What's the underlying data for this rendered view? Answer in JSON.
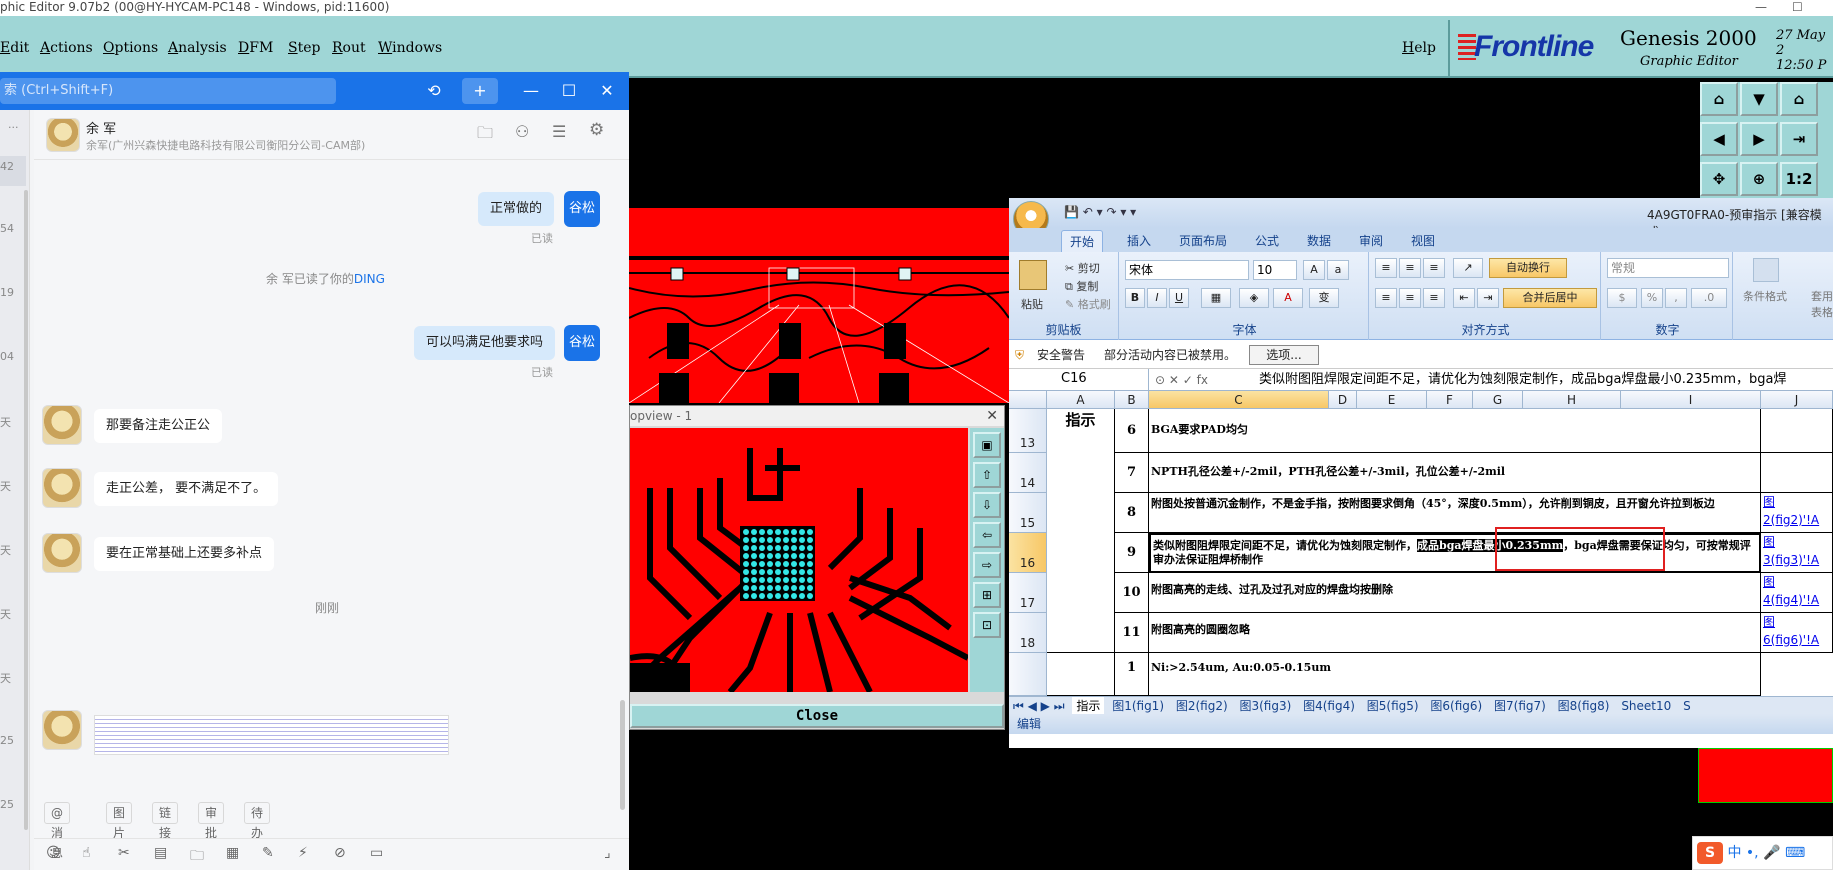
{
  "window": {
    "title": "phic Editor 9.07b2 (00@HY-HYCAM-PC148 - Windows, pid:11600)",
    "controls": [
      "—",
      "☐"
    ]
  },
  "genesis": {
    "menu": [
      "Edit",
      "Actions",
      "Options",
      "Analysis",
      "DFM",
      "Step",
      "Rout",
      "Windows"
    ],
    "help": "Help",
    "logo": "Frontline",
    "product": "Genesis 2000",
    "subtitle": "Graphic Editor",
    "date": "27 May 2",
    "time": "12:50 P",
    "toolbar_ratio": "1:2"
  },
  "chat": {
    "search_placeholder": "索 (Ctrl+Shift+F)",
    "contact_name": "余 军",
    "contact_org": "余军(广州兴森快捷电路科技有限公司衡阳分公司-CAM部)",
    "sidebar_times": [
      "42",
      "54",
      "19",
      "04",
      "天",
      "天",
      "天",
      "天",
      "天",
      "25",
      "25"
    ],
    "sidebar_dots": "...",
    "messages": [
      {
        "from": "me",
        "text": "正常做的",
        "badge": "谷松",
        "status": "已读"
      },
      {
        "from": "system",
        "text_pre": "余 军已读了你的",
        "text_link": "DING"
      },
      {
        "from": "me",
        "text": "可以吗满足他要求吗",
        "badge": "谷松",
        "status": "已读"
      },
      {
        "from": "other",
        "text": "那要备注走公正公"
      },
      {
        "from": "other",
        "text": "走正公差， 要不满足不了。"
      },
      {
        "from": "other",
        "text": "要在正常基础上还要多补点"
      },
      {
        "from": "time",
        "text": "刚刚"
      }
    ],
    "quick_actions": [
      "@消息",
      "图片",
      "链接",
      "审批",
      "待办"
    ]
  },
  "popview": {
    "title": "opview - 1",
    "close_label": "Close"
  },
  "excel": {
    "title": "4A9GT0FRA0-预审指示 [兼容模式",
    "tabs": [
      "开始",
      "插入",
      "页面布局",
      "公式",
      "数据",
      "审阅",
      "视图"
    ],
    "ribbon": {
      "paste": "粘贴",
      "cut": "剪切",
      "copy": "复制",
      "format_painter": "格式刷",
      "clipboard": "剪贴板",
      "font_name": "宋体",
      "font_size": "10",
      "font_group": "字体",
      "wrap": "自动换行",
      "merge": "合并后居中",
      "align_group": "对齐方式",
      "number_format": "常规",
      "number_group": "数字",
      "cond_format": "条件格式",
      "table_format": "套用\n表格格"
    },
    "security_label": "安全警告",
    "security_text": "部分活动内容已被禁用。",
    "security_btn": "选项...",
    "namebox": "C16",
    "formula": "类似附图阻焊限定间距不足，请优化为蚀刻限定制作，成品bga焊盘最小0.235mm，bga焊",
    "columns": [
      "A",
      "B",
      "C",
      "D",
      "E",
      "F",
      "G",
      "H",
      "I",
      "J"
    ],
    "section_label": "指示",
    "rows": [
      {
        "row": "13",
        "num": "6",
        "text": "BGA要求PAD均匀",
        "link": ""
      },
      {
        "row": "14",
        "num": "7",
        "text": "NPTH孔径公差+/-2mil，PTH孔径公差+/-3mil，孔位公差+/-2mil",
        "link": ""
      },
      {
        "row": "15",
        "num": "8",
        "text": "附图处按普通沉金制作，不是金手指，按附图要求倒角（45°，深度0.5mm），允许削到铜皮，且开窗允许拉到板边",
        "link": "图\n2(fig2)'!A"
      },
      {
        "row": "16",
        "num": "9",
        "text_pre": "类似附图阻焊限定间距不足，请优化为蚀刻限定制作，",
        "text_sel": "成品bga焊盘最小0.235mm",
        "text_post": "，bga焊盘需要保证均匀，可按常规评审办法保证阻焊桥制作",
        "link": "图\n3(fig3)'!A"
      },
      {
        "row": "17",
        "num": "10",
        "text": "附图高亮的走线、过孔及过孔对应的焊盘均按删除",
        "link": "图\n4(fig4)'!A"
      },
      {
        "row": "18",
        "num": "11",
        "text": "附图高亮的圆圈忽略",
        "link": "图\n6(fig6)'!A"
      },
      {
        "row": "",
        "num": "1",
        "text": "Ni:>2.54um, Au:0.05-0.15um",
        "link": ""
      }
    ],
    "sheets": [
      "指示",
      "图1(fig1)",
      "图2(fig2)",
      "图3(fig3)",
      "图4(fig4)",
      "图5(fig5)",
      "图6(fig6)",
      "图7(fig7)",
      "图8(fig8)",
      "Sheet10",
      "S"
    ],
    "status": "编辑"
  },
  "tray": {
    "ime": "S",
    "lang": "中",
    "items": "•, 🎤 ⌨"
  }
}
